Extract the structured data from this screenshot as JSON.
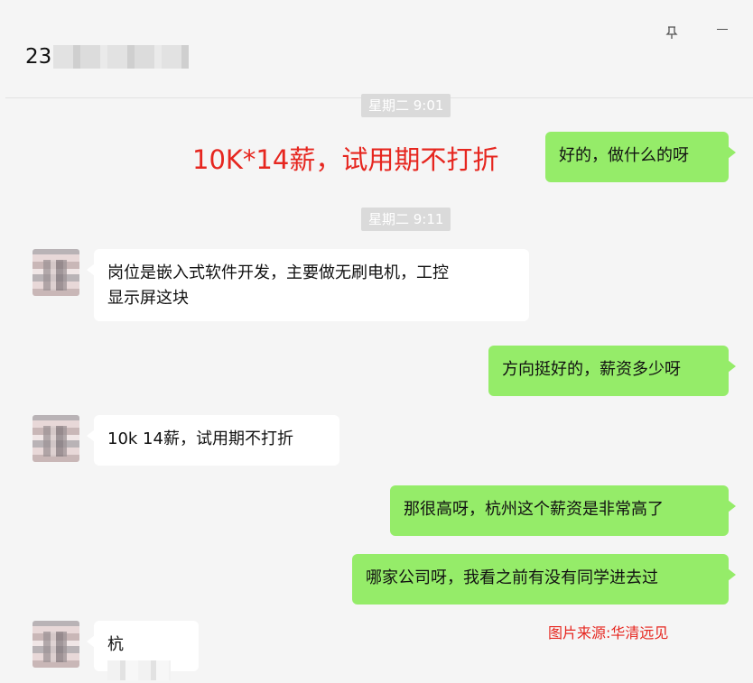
{
  "header": {
    "contact_name_visible": "23",
    "pin_icon": "pin-icon",
    "minimize_icon": "minimize-icon"
  },
  "chat": {
    "timestamps": [
      "星期二 9:01",
      "星期二 9:11"
    ],
    "messages": [
      {
        "sender": "me",
        "text": "好的，做什么的呀"
      },
      {
        "sender": "other",
        "text_line1": "岗位是嵌入式软件开发，主要做无刷电机，工控",
        "text_line2": "显示屏这块"
      },
      {
        "sender": "me",
        "text": "方向挺好的，薪资多少呀"
      },
      {
        "sender": "other",
        "text": "10k 14薪，试用期不打折"
      },
      {
        "sender": "me",
        "text": "那很高呀，杭州这个薪资是非常高了"
      },
      {
        "sender": "me",
        "text": "哪家公司呀，我看之前有没有同学进去过"
      },
      {
        "sender": "other",
        "text_visible": "杭"
      }
    ]
  },
  "overlay": {
    "highlight_text": "10K*14薪，试用期不打折",
    "watermark_text": "图片来源:华清远见",
    "highlight_color": "#e6261f"
  },
  "colors": {
    "my_bubble": "#95ec69",
    "other_bubble": "#ffffff",
    "background": "#f5f5f5"
  }
}
